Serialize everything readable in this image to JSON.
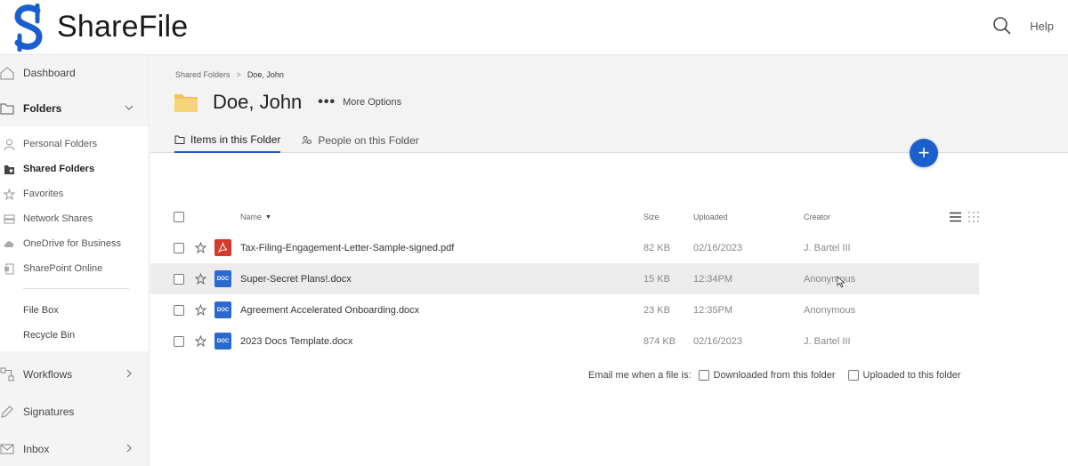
{
  "app": {
    "brand": "ShareFile",
    "help_label": "Help"
  },
  "colors": {
    "brand_blue": "#1b5fcf",
    "pdf_red": "#d43a2a",
    "doc_blue": "#2a6acf",
    "tab_underline": "#1f5bc6"
  },
  "sidebar": {
    "dashboard": "Dashboard",
    "folders": "Folders",
    "folder_items": [
      {
        "label": "Personal Folders",
        "icon": "person-icon"
      },
      {
        "label": "Shared Folders",
        "icon": "shared-folder-icon"
      },
      {
        "label": "Favorites",
        "icon": "star-icon"
      },
      {
        "label": "Network Shares",
        "icon": "server-icon"
      },
      {
        "label": "OneDrive for Business",
        "icon": "cloud-icon"
      },
      {
        "label": "SharePoint Online",
        "icon": "sharepoint-icon"
      }
    ],
    "file_box": "File Box",
    "recycle_bin": "Recycle Bin",
    "workflows": "Workflows",
    "signatures": "Signatures",
    "inbox": "Inbox"
  },
  "breadcrumb": {
    "parent": "Shared Folders",
    "separator": ">",
    "current": "Doe, John"
  },
  "page": {
    "title": "Doe, John",
    "more_options": "More Options"
  },
  "tabs": [
    {
      "label": "Items in this Folder",
      "icon": "folder-icon",
      "active": true
    },
    {
      "label": "People on this Folder",
      "icon": "people-icon",
      "active": false
    }
  ],
  "add_button": "+",
  "table": {
    "columns": {
      "name": "Name",
      "size": "Size",
      "uploaded": "Uploaded",
      "creator": "Creator"
    },
    "sort_indicator": "▼",
    "rows": [
      {
        "type": "pdf",
        "type_label": "",
        "name": "Tax-Filing-Engagement-Letter-Sample-signed.pdf",
        "size": "82 KB",
        "uploaded": "02/16/2023",
        "creator": "J. Bartel III"
      },
      {
        "type": "doc",
        "type_label": "DOC",
        "name": "Super-Secret Plans!.docx",
        "size": "15 KB",
        "uploaded": "12:34PM",
        "creator": "Anonymous"
      },
      {
        "type": "doc",
        "type_label": "DOC",
        "name": "Agreement Accelerated Onboarding.docx",
        "size": "23 KB",
        "uploaded": "12:35PM",
        "creator": "Anonymous"
      },
      {
        "type": "doc",
        "type_label": "DOC",
        "name": "2023 Docs Template.docx",
        "size": "874 KB",
        "uploaded": "02/16/2023",
        "creator": "J. Bartel III"
      }
    ]
  },
  "email_notify": {
    "prefix": "Email me when a file is:",
    "downloaded": "Downloaded from this folder",
    "uploaded": "Uploaded to this folder"
  }
}
